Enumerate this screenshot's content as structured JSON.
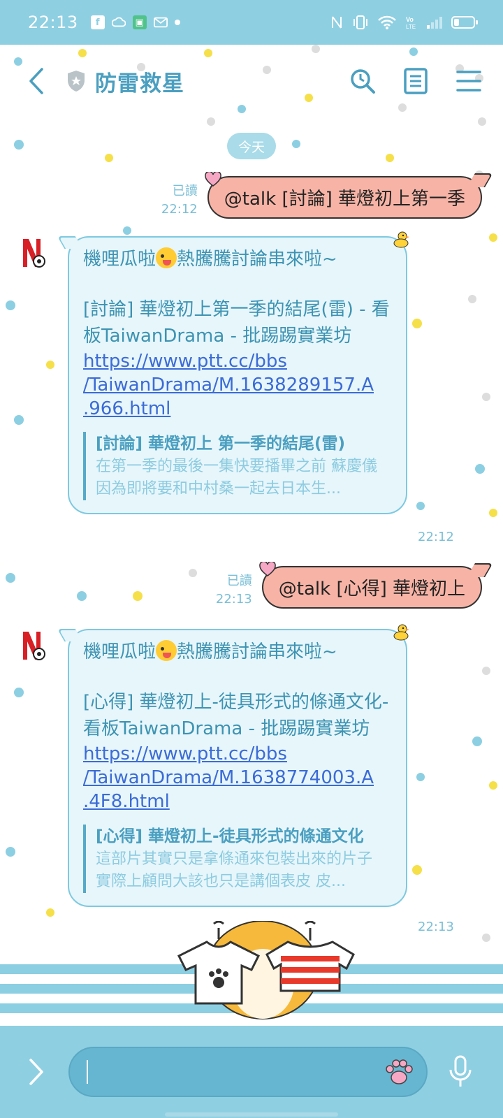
{
  "status_bar": {
    "time": "22:13"
  },
  "header": {
    "title": "防雷救星"
  },
  "date_divider": "今天",
  "messages": [
    {
      "direction": "out",
      "read_label": "已讀",
      "time": "22:12",
      "text": "@talk [討論] 華燈初上第一季"
    },
    {
      "direction": "in",
      "line1": "機哩瓜啦",
      "line1_after": "熱騰騰討論串來啦~",
      "line2": "[討論] 華燈初上第一季的結尾(雷) - 看板TaiwanDrama - 批踢踢實業坊",
      "link": "https://www.ptt.cc/bbs/TaiwanDrama/M.1638289157.A.966.html",
      "link_parts": [
        "https://www.ptt.cc/bbs",
        "/TaiwanDrama/M.1638289157.A",
        ".966.html"
      ],
      "preview_title": "[討論] 華燈初上 第一季的結尾(雷)",
      "preview_desc": "在第一季的最後一集快要播畢之前 蘇慶儀因為即將要和中村桑一起去日本生...",
      "time": "22:12"
    },
    {
      "direction": "out",
      "read_label": "已讀",
      "time": "22:13",
      "text": "@talk [心得] 華燈初上"
    },
    {
      "direction": "in",
      "line1": "機哩瓜啦",
      "line1_after": "熱騰騰討論串來啦~",
      "line2": "[心得] 華燈初上-徒具形式的條通文化- 看板TaiwanDrama - 批踢踢實業坊",
      "link": "https://www.ptt.cc/bbs/TaiwanDrama/M.1638774003.A.4F8.html",
      "link_parts": [
        "https://www.ptt.cc/bbs",
        "/TaiwanDrama/M.1638774003.A",
        ".4F8.html"
      ],
      "preview_title": "[心得] 華燈初上-徒具形式的條通文化",
      "preview_desc": "這部片其實只是拿條通來包裝出來的片子 實際上顧問大該也只是講個表皮 皮...",
      "time": "22:13"
    }
  ],
  "input": {
    "value": ""
  },
  "colors": {
    "theme": "#8ecfe2",
    "title": "#4a9fc0",
    "outgoing_bubble": "#f7b4a6",
    "incoming_bubble": "#e7f6fb",
    "link": "#3b6bd6"
  }
}
